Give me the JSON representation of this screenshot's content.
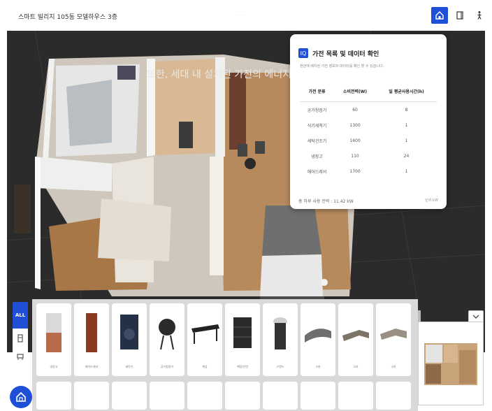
{
  "header": {
    "title": "스마트 빌리지 105동 모델하우스 3층",
    "center_mark": "·  ·"
  },
  "viewport": {
    "banner": "또한, 세대 내 설치된 가전의 에너지 사용량도 확인할 수 있습니다."
  },
  "panel": {
    "badge": "IQ",
    "title": "가전 목록 및 데이터 확인",
    "desc": "현관에 배치된 가전 정보와 데이터를 확인 할 수 있습니다.",
    "columns": [
      "가전 분류",
      "소비전력(W)",
      "일 평균사용시간(h)"
    ],
    "rows": [
      [
        "공기청정기",
        "60",
        "8"
      ],
      [
        "식기세척기",
        "1300",
        "1"
      ],
      [
        "세탁건조기",
        "1600",
        "1"
      ],
      [
        "냉장고",
        "110",
        "24"
      ],
      [
        "에어드레서",
        "1700",
        "1"
      ]
    ],
    "footer": "총 하루 사용 전력 : 11.42 kW",
    "unit": "단위:kW"
  },
  "categories": {
    "all_label": "ALL"
  },
  "tray": {
    "items": [
      {
        "label": "냉장고",
        "color": "#b86a4a"
      },
      {
        "label": "에어드레서",
        "color": "#8a3a22"
      },
      {
        "label": "세탁기",
        "color": "#243046"
      },
      {
        "label": "공기청정기",
        "color": "#2b2b2b"
      },
      {
        "label": "책상",
        "color": "#222222"
      },
      {
        "label": "책장/선반",
        "color": "#2a2a2a"
      },
      {
        "label": "스탠드",
        "color": "#333333"
      },
      {
        "label": "소파",
        "color": "#6e6e6e"
      },
      {
        "label": "소파",
        "color": "#7d7468"
      },
      {
        "label": "소파",
        "color": "#9a8f80"
      }
    ]
  },
  "colors": {
    "accent": "#1f4fd6",
    "viewport_bg": "#2b2b2b"
  }
}
